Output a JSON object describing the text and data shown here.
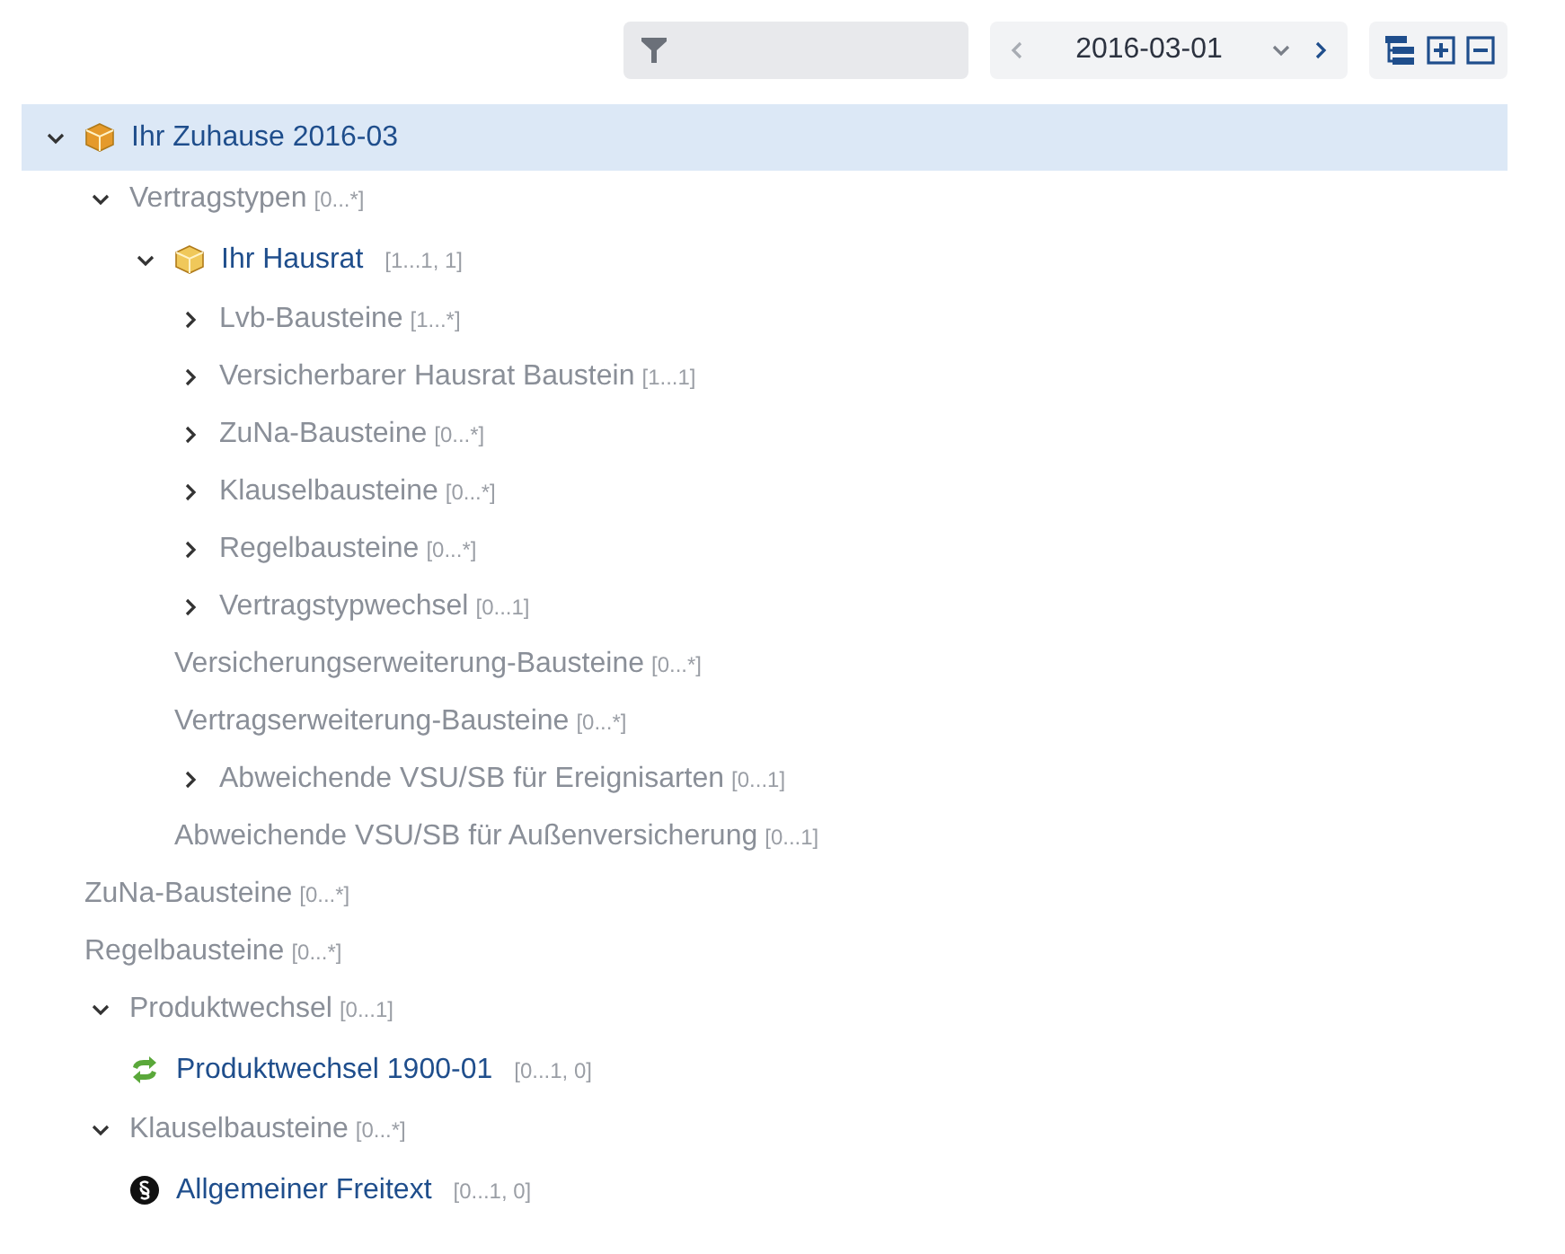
{
  "toolbar": {
    "date": {
      "value": "2016-03-01"
    }
  },
  "tree": [
    {
      "kind": "contract",
      "label": "Ihr Zuhause 2016-03",
      "expanded": true,
      "selected": true,
      "children": [
        {
          "kind": "group",
          "label": "Vertragstypen",
          "cardinality": "[0...*]",
          "expanded": true,
          "children": [
            {
              "kind": "package",
              "label": "Ihr Hausrat",
              "cardinality": "[1...1, 1]",
              "expanded": true,
              "selected": false,
              "children": [
                {
                  "kind": "group",
                  "label": "Lvb-Bausteine",
                  "cardinality": "[1...*]",
                  "expanded": false
                },
                {
                  "kind": "group",
                  "label": "Versicherbarer Hausrat Baustein",
                  "cardinality": "[1...1]",
                  "expanded": false
                },
                {
                  "kind": "group",
                  "label": "ZuNa-Bausteine",
                  "cardinality": "[0...*]",
                  "expanded": false
                },
                {
                  "kind": "group",
                  "label": "Klauselbausteine",
                  "cardinality": "[0...*]",
                  "expanded": false
                },
                {
                  "kind": "group",
                  "label": "Regelbausteine",
                  "cardinality": "[0...*]",
                  "expanded": false
                },
                {
                  "kind": "group",
                  "label": "Vertragstypwechsel",
                  "cardinality": "[0...1]",
                  "expanded": false
                },
                {
                  "kind": "group",
                  "label": "Versicherungserweiterung-Bausteine",
                  "cardinality": "[0...*]"
                },
                {
                  "kind": "group",
                  "label": "Vertragserweiterung-Bausteine",
                  "cardinality": "[0...*]"
                },
                {
                  "kind": "group",
                  "label": "Abweichende VSU/SB für Ereignisarten",
                  "cardinality": "[0...1]",
                  "expanded": false
                },
                {
                  "kind": "group",
                  "label": "Abweichende VSU/SB für Außenversicherung",
                  "cardinality": "[0...1]"
                }
              ]
            }
          ]
        },
        {
          "kind": "group",
          "label": "ZuNa-Bausteine",
          "cardinality": "[0...*]"
        },
        {
          "kind": "group",
          "label": "Regelbausteine",
          "cardinality": "[0...*]"
        },
        {
          "kind": "group",
          "label": "Produktwechsel",
          "cardinality": "[0...1]",
          "expanded": true,
          "children": [
            {
              "kind": "change",
              "label": "Produktwechsel 1900-01",
              "cardinality": "[0...1, 0]",
              "selected": false
            }
          ]
        },
        {
          "kind": "group",
          "label": "Klauselbausteine",
          "cardinality": "[0...*]",
          "expanded": true,
          "children": [
            {
              "kind": "clause",
              "label": "Allgemeiner Freitext",
              "cardinality": "[0...1, 0]",
              "selected": false
            }
          ]
        }
      ]
    }
  ]
}
